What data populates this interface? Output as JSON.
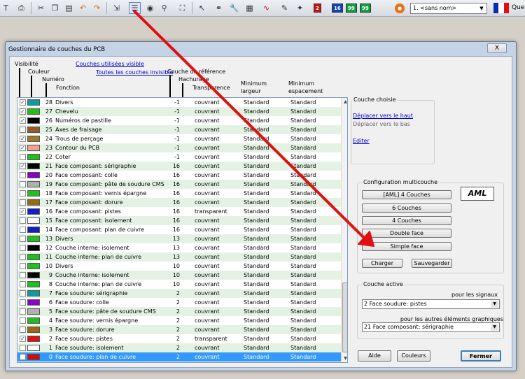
{
  "toolbar": {
    "net_value": "1. <sans nom>",
    "quit_label": "Que",
    "num_badges": [
      "2",
      "16",
      "99",
      "99"
    ]
  },
  "window": {
    "title": "Gestionnaire de couches du PCB",
    "close_label": "X"
  },
  "headers": {
    "visibilite": "Visibilité",
    "couleur": "Couleur",
    "numero": "Numéro",
    "fonction": "Fonction",
    "couches_utilisees": "Couches utilisées visible",
    "toutes_invisible": "Toutes les couches invisible",
    "couche_ref": "Couche de référence",
    "hachurage": "Hachurage",
    "transparence": "Transparence",
    "min_largeur_1": "Minimum",
    "min_largeur_2": "largeur",
    "min_espacement_1": "Minimum",
    "min_espacement_2": "espacement"
  },
  "rows": [
    {
      "chk": true,
      "color": "#0e9aa5",
      "num": "28",
      "name": "Divers",
      "ref": "-1",
      "hatch": "couvrant",
      "width": "Standard",
      "space": "Standard"
    },
    {
      "chk": true,
      "color": "#1fbf1f",
      "num": "27",
      "name": "Chevelu",
      "ref": "-1",
      "hatch": "couvrant",
      "width": "Standard",
      "space": "Standard"
    },
    {
      "chk": true,
      "color": "#000000",
      "num": "26",
      "name": "Numéros de pastille",
      "ref": "-1",
      "hatch": "couvrant",
      "width": "Standard",
      "space": "Standard"
    },
    {
      "chk": false,
      "color": "#9c5a2a",
      "num": "25",
      "name": "Axes de fraisage",
      "ref": "-1",
      "hatch": "couvrant",
      "width": "Standard",
      "space": "Standard"
    },
    {
      "chk": true,
      "color": "#9a7a22",
      "num": "24",
      "name": "Trous de perçage",
      "ref": "-1",
      "hatch": "couvrant",
      "width": "Standard",
      "space": "Standard"
    },
    {
      "chk": true,
      "color": "#ff9a9a",
      "num": "23",
      "name": "Contour du PCB",
      "ref": "-1",
      "hatch": "couvrant",
      "width": "Standard",
      "space": "Standard"
    },
    {
      "chk": false,
      "color": "#1fbf1f",
      "num": "22",
      "name": "Coter",
      "ref": "-1",
      "hatch": "couvrant",
      "width": "Standard",
      "space": "Standard"
    },
    {
      "chk": true,
      "color": "#000000",
      "num": "21",
      "name": "Face composant: sérigraphie",
      "ref": "16",
      "hatch": "couvrant",
      "width": "Standard",
      "space": "Standard"
    },
    {
      "chk": false,
      "color": "#8a00c8",
      "num": "20",
      "name": "Face composant: colle",
      "ref": "16",
      "hatch": "couvrant",
      "width": "Standard",
      "space": "Standard"
    },
    {
      "chk": false,
      "color": "#b0b0b0",
      "num": "19",
      "name": "Face composant: pâte de soudure CMS",
      "ref": "16",
      "hatch": "couvrant",
      "width": "Standard",
      "space": "Standard"
    },
    {
      "chk": false,
      "color": "#1fbf1f",
      "num": "18",
      "name": "Face composant: vernis épargne",
      "ref": "16",
      "hatch": "couvrant",
      "width": "Standard",
      "space": "Standard"
    },
    {
      "chk": false,
      "color": "#9a6a10",
      "num": "17",
      "name": "Face composant: dorure",
      "ref": "16",
      "hatch": "couvrant",
      "width": "Standard",
      "space": "Standard"
    },
    {
      "chk": true,
      "color": "#1020c8",
      "num": "16",
      "name": "Face composant: pistes",
      "ref": "16",
      "hatch": "transparent",
      "width": "Standard",
      "space": "Standard"
    },
    {
      "chk": false,
      "color": "#ffffff",
      "num": "15",
      "name": "Face composant: isolement",
      "ref": "16",
      "hatch": "couvrant",
      "width": "Standard",
      "space": "Standard"
    },
    {
      "chk": false,
      "color": "#1020c8",
      "num": "14",
      "name": "Face composant: plan de cuivre",
      "ref": "16",
      "hatch": "couvrant",
      "width": "Standard",
      "space": "Standard"
    },
    {
      "chk": false,
      "color": "#1fbf1f",
      "num": "13",
      "name": "Divers",
      "ref": "13",
      "hatch": "couvrant",
      "width": "Standard",
      "space": "Standard"
    },
    {
      "chk": false,
      "color": "#000000",
      "num": "12",
      "name": "Couche interne: isolement",
      "ref": "13",
      "hatch": "couvrant",
      "width": "Standard",
      "space": "Standard"
    },
    {
      "chk": false,
      "color": "#1fbf1f",
      "num": "11",
      "name": "Couche interne: plan de cuivre",
      "ref": "13",
      "hatch": "couvrant",
      "width": "Standard",
      "space": "Standard"
    },
    {
      "chk": false,
      "color": "#1fbf1f",
      "num": "10",
      "name": "Divers",
      "ref": "10",
      "hatch": "couvrant",
      "width": "Standard",
      "space": "Standard"
    },
    {
      "chk": false,
      "color": "#000000",
      "num": "9",
      "name": "Couche interne: isolement",
      "ref": "10",
      "hatch": "couvrant",
      "width": "Standard",
      "space": "Standard"
    },
    {
      "chk": false,
      "color": "#1fbf1f",
      "num": "8",
      "name": "Couche interne: plan de cuivre",
      "ref": "10",
      "hatch": "couvrant",
      "width": "Standard",
      "space": "Standard"
    },
    {
      "chk": false,
      "color": "#0e9aa5",
      "num": "7",
      "name": "Face soudure: sérigraphie",
      "ref": "2",
      "hatch": "couvrant",
      "width": "Standard",
      "space": "Standard"
    },
    {
      "chk": false,
      "color": "#8a00c8",
      "num": "6",
      "name": "Face soudure: colle",
      "ref": "2",
      "hatch": "couvrant",
      "width": "Standard",
      "space": "Standard"
    },
    {
      "chk": false,
      "color": "#b0b0b0",
      "num": "5",
      "name": "Face soudure: pâte de soudure CMS",
      "ref": "2",
      "hatch": "couvrant",
      "width": "Standard",
      "space": "Standard"
    },
    {
      "chk": false,
      "color": "#1fbf1f",
      "num": "4",
      "name": "Face soudure: vernis épargne",
      "ref": "2",
      "hatch": "couvrant",
      "width": "Standard",
      "space": "Standard"
    },
    {
      "chk": false,
      "color": "#9a6a10",
      "num": "3",
      "name": "Face soudure: dorure",
      "ref": "2",
      "hatch": "couvrant",
      "width": "Standard",
      "space": "Standard"
    },
    {
      "chk": true,
      "color": "#e01010",
      "num": "2",
      "name": "Face soudure: pistes",
      "ref": "2",
      "hatch": "transparent",
      "width": "Standard",
      "space": "Standard"
    },
    {
      "chk": false,
      "color": "#ffffff",
      "num": "1",
      "name": "Face soudure: isolement",
      "ref": "2",
      "hatch": "couvrant",
      "width": "Standard",
      "space": "Standard"
    },
    {
      "chk": false,
      "color": "#c81010",
      "num": "0",
      "name": "Face soudure: plan de cuivre",
      "ref": "2",
      "hatch": "couvrant",
      "width": "Standard",
      "space": "Standard",
      "selected": true
    }
  ],
  "right": {
    "couche_choisie": "Couche choisie",
    "move_up": "Déplacer vers le haut",
    "move_down": "Déplacer vers le bas",
    "edit": "Editer",
    "multi_title": "Configuration multicouche",
    "aml4": "[AML] 4 Couches",
    "c6": "6 Couches",
    "c4": "4 Couches",
    "double": "Double face",
    "simple": "Simple face",
    "logo": "AML",
    "charger": "Charger",
    "sauver": "Sauvegarder",
    "active_title": "Couche active",
    "signals_label": "pour les signaux",
    "signals_value": "2 Face soudure: pistes",
    "other_label": "pour les autres éléments graphiques",
    "other_value": "21 Face composant: sérigraphie",
    "aide": "Aide",
    "couleurs": "Couleurs",
    "fermer": "Fermer"
  },
  "colors": {
    "arrow": "#e01010",
    "link": "#0000cc",
    "selection": "#3399ff",
    "row_alt": "#e4f2e4"
  }
}
